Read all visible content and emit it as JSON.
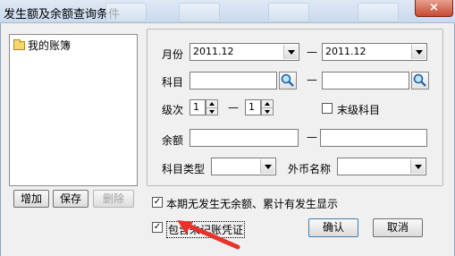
{
  "window": {
    "title": "发生额及余额查询条件",
    "close_label": "×"
  },
  "tree": {
    "items": [
      {
        "label": "我的账簿"
      }
    ]
  },
  "tree_buttons": {
    "add": "增加",
    "save": "保存",
    "delete": "删除"
  },
  "form": {
    "month_label": "月份",
    "month_from": "2011.12",
    "month_to": "2011.12",
    "subject_label": "科目",
    "subject_from": "",
    "subject_to": "",
    "level_label": "级次",
    "level_from": "1",
    "level_to": "1",
    "leaf_subject_label": "末级科目",
    "balance_label": "余额",
    "balance_from": "",
    "balance_to": "",
    "subject_type_label": "科目类型",
    "subject_type_value": "",
    "currency_label": "外币名称",
    "currency_value": "",
    "dash": "—"
  },
  "options": {
    "show_no_activity_label": "本期无发生无余额、累计有发生显示",
    "show_no_activity_checked": true,
    "include_unposted_label": "包含未记账凭证",
    "include_unposted_checked": true
  },
  "buttons": {
    "ok": "确认",
    "cancel": "取消"
  },
  "colors": {
    "annotation_arrow": "#e8322a"
  }
}
